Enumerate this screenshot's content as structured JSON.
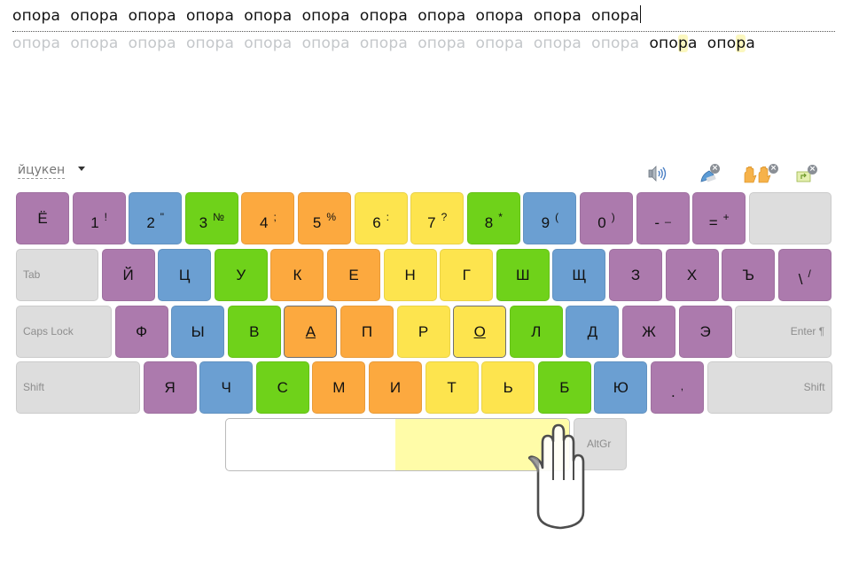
{
  "typing": {
    "typed_words": [
      "опора",
      "опора",
      "опора",
      "опора",
      "опора",
      "опора",
      "опора",
      "опора",
      "опора",
      "опора",
      "опора"
    ],
    "target_done_words": [
      "опора",
      "опора",
      "опора",
      "опора",
      "опора",
      "опора",
      "опора",
      "опора",
      "опора",
      "опора",
      "опора"
    ],
    "target_pending_words": [
      {
        "pre": "опо",
        "hl": "р",
        "post": "а"
      },
      {
        "pre": "опо",
        "hl": "р",
        "post": "а"
      }
    ]
  },
  "layout_selector": {
    "label": "йцукен"
  },
  "toolbar": {
    "icons": [
      {
        "name": "sound-icon"
      },
      {
        "name": "hint-pen-icon"
      },
      {
        "name": "hands-icon"
      },
      {
        "name": "keyboard-hide-icon"
      }
    ]
  },
  "colors": {
    "purple": "#ac7aad",
    "blue": "#6b9fd2",
    "green": "#6fd21a",
    "orange": "#fca93f",
    "yellow": "#fde44e",
    "gray": "#dddddd",
    "thumb_highlight": "#fffca8"
  },
  "keyboard": {
    "row1": [
      {
        "main": "Ё",
        "color": "purple"
      },
      {
        "main": "1",
        "sup": "!",
        "color": "purple"
      },
      {
        "main": "2",
        "sup": "\"",
        "color": "blue"
      },
      {
        "main": "3",
        "sup": "№",
        "color": "green"
      },
      {
        "main": "4",
        "sup": ";",
        "color": "orange"
      },
      {
        "main": "5",
        "sup": "%",
        "color": "orange"
      },
      {
        "main": "6",
        "sup": ":",
        "color": "yellow"
      },
      {
        "main": "7",
        "sup": "?",
        "color": "yellow"
      },
      {
        "main": "8",
        "sup": "*",
        "color": "green"
      },
      {
        "main": "9",
        "sup": "(",
        "color": "blue"
      },
      {
        "main": "0",
        "sup": ")",
        "color": "purple"
      },
      {
        "main": "-",
        "sup": "_",
        "color": "purple"
      },
      {
        "main": "=",
        "sup": "+",
        "color": "purple"
      },
      {
        "fn": "",
        "color": "gray",
        "name": "backspace"
      }
    ],
    "row2": [
      {
        "fn": "Tab",
        "color": "gray",
        "name": "tab"
      },
      {
        "main": "Й",
        "color": "purple"
      },
      {
        "main": "Ц",
        "color": "blue"
      },
      {
        "main": "У",
        "color": "green"
      },
      {
        "main": "К",
        "color": "orange"
      },
      {
        "main": "Е",
        "color": "orange"
      },
      {
        "main": "Н",
        "color": "yellow"
      },
      {
        "main": "Г",
        "color": "yellow"
      },
      {
        "main": "Ш",
        "color": "green"
      },
      {
        "main": "Щ",
        "color": "blue"
      },
      {
        "main": "З",
        "color": "purple"
      },
      {
        "main": "Х",
        "color": "purple"
      },
      {
        "main": "Ъ",
        "color": "purple"
      },
      {
        "main": "\\",
        "sup": "/",
        "color": "purple"
      }
    ],
    "row3": [
      {
        "fn": "Caps Lock",
        "color": "gray",
        "name": "caps-lock"
      },
      {
        "main": "Ф",
        "color": "purple"
      },
      {
        "main": "Ы",
        "color": "blue"
      },
      {
        "main": "В",
        "color": "green"
      },
      {
        "main": "А",
        "color": "orange",
        "home": true
      },
      {
        "main": "П",
        "color": "orange"
      },
      {
        "main": "Р",
        "color": "yellow"
      },
      {
        "main": "О",
        "color": "yellow",
        "home": true
      },
      {
        "main": "Л",
        "color": "green"
      },
      {
        "main": "Д",
        "color": "blue"
      },
      {
        "main": "Ж",
        "color": "purple"
      },
      {
        "main": "Э",
        "color": "purple"
      },
      {
        "fn": "Enter ¶",
        "color": "gray",
        "name": "enter",
        "align": "right"
      }
    ],
    "row4": [
      {
        "fn": "Shift",
        "color": "gray",
        "name": "left-shift"
      },
      {
        "main": "Я",
        "color": "purple"
      },
      {
        "main": "Ч",
        "color": "blue"
      },
      {
        "main": "С",
        "color": "green"
      },
      {
        "main": "М",
        "color": "orange"
      },
      {
        "main": "И",
        "color": "orange"
      },
      {
        "main": "Т",
        "color": "yellow"
      },
      {
        "main": "Ь",
        "color": "yellow"
      },
      {
        "main": "Б",
        "color": "green"
      },
      {
        "main": "Ю",
        "color": "blue"
      },
      {
        "main": ".",
        "sup": ",",
        "color": "purple"
      },
      {
        "fn": "Shift",
        "color": "gray",
        "name": "right-shift",
        "align": "right"
      }
    ],
    "altgr_label": "AltGr"
  }
}
